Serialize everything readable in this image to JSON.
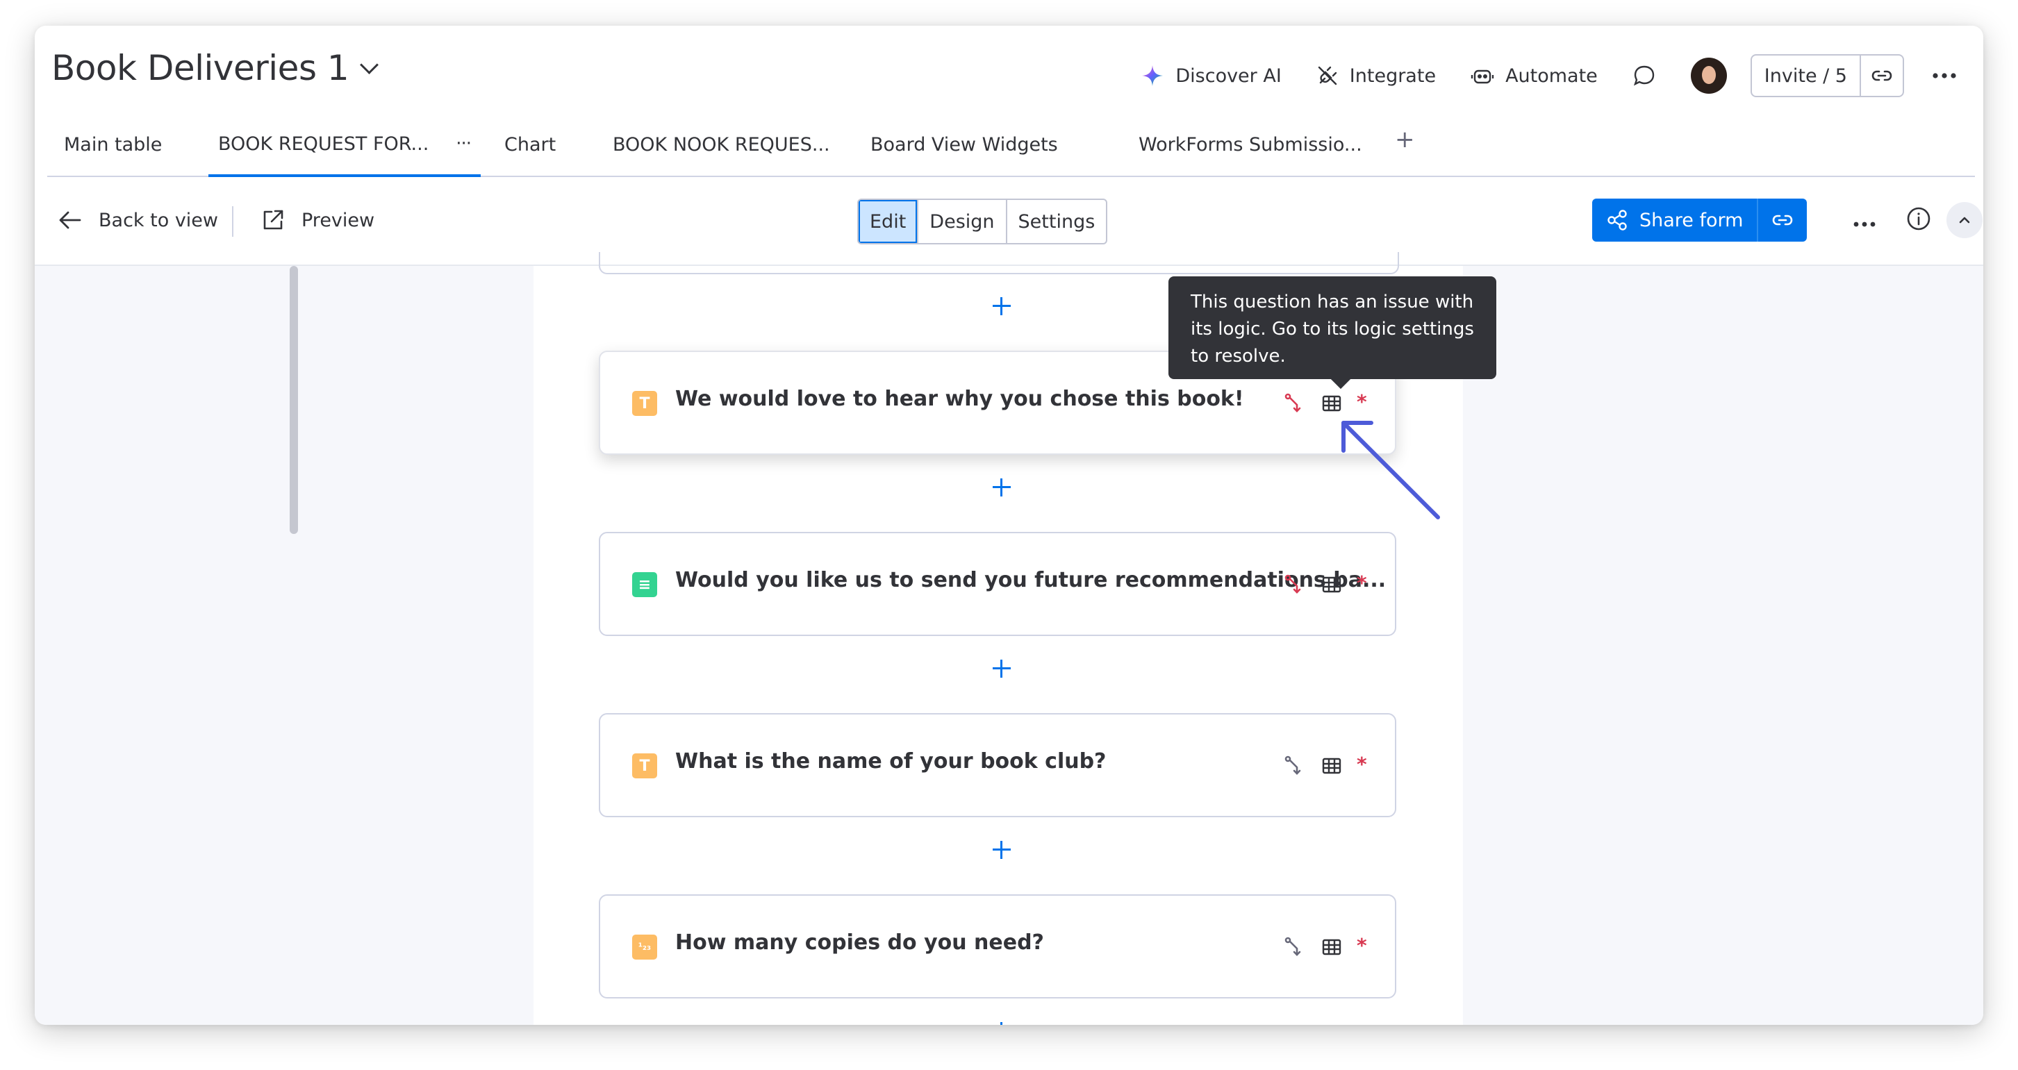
{
  "board": {
    "title": "Book Deliveries 1"
  },
  "top_actions": {
    "discover_ai": "Discover AI",
    "integrate": "Integrate",
    "automate": "Automate",
    "invite": "Invite / 5"
  },
  "tabs": [
    {
      "label": "Main table"
    },
    {
      "label": "BOOK REQUEST FOR..."
    },
    {
      "label": "Chart"
    },
    {
      "label": "BOOK NOOK REQUES..."
    },
    {
      "label": "Board View Widgets"
    },
    {
      "label": "WorkForms Submissio..."
    }
  ],
  "tab_more": "···",
  "tab_add": "+",
  "toolbar": {
    "back": "Back to view",
    "preview": "Preview",
    "modes": [
      "Edit",
      "Design",
      "Settings"
    ],
    "active_mode": "Edit",
    "share": "Share form"
  },
  "tooltip": {
    "text": "This question has an issue with its logic. Go to its logic settings to resolve."
  },
  "questions": [
    {
      "text": "We would love to hear why you chose this book!",
      "type": "text",
      "type_icon": "T",
      "logic_issue": true,
      "required": "*"
    },
    {
      "text": "Would you like us to send you future recommendations ba...",
      "type": "dropdown",
      "type_icon": "≡",
      "logic_issue": true,
      "required": "*"
    },
    {
      "text": "What is the name of your book club?",
      "type": "text",
      "type_icon": "T",
      "logic_issue": false,
      "required": "*"
    },
    {
      "text": "How many copies do you need?",
      "type": "numbers",
      "type_icon": "¹₂₃",
      "logic_issue": false,
      "required": "*"
    }
  ],
  "colors": {
    "accent": "#0073ea",
    "text_icon_bg": "#fdbc64",
    "dropdown_icon_bg": "#33d391",
    "logic_error": "#d83a52",
    "annotation_arrow": "#4d5bd8"
  }
}
